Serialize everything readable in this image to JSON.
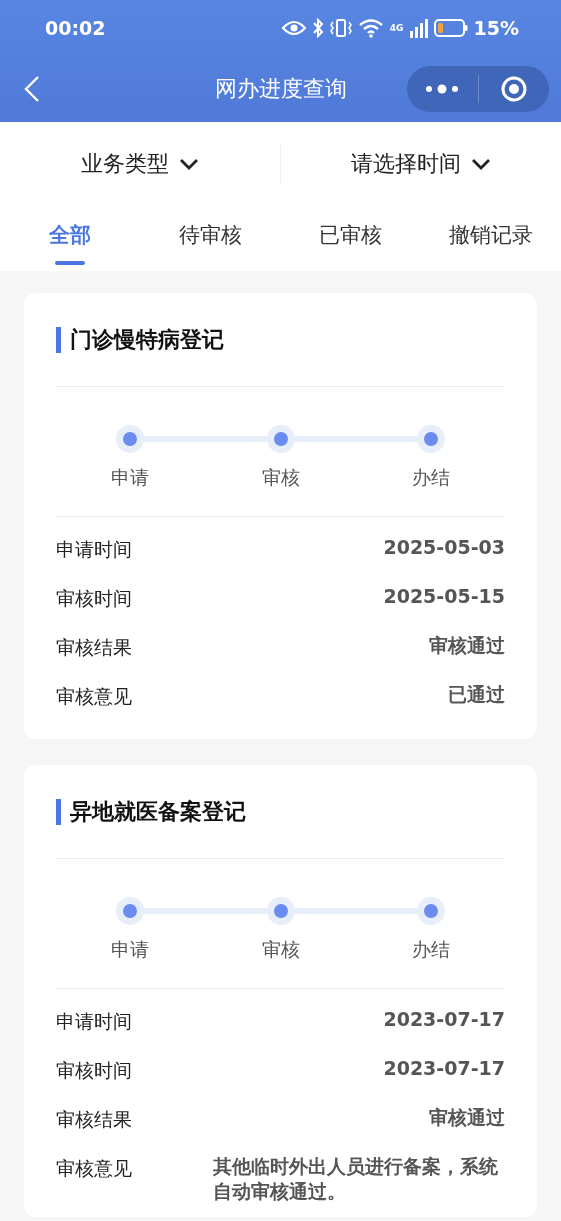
{
  "status_bar": {
    "time": "00:02",
    "network_type": "4G",
    "battery": "15%"
  },
  "nav_bar": {
    "title": "网办进度查询"
  },
  "filters": [
    {
      "label": "业务类型"
    },
    {
      "label": "请选择时间"
    }
  ],
  "tabs": [
    {
      "label": "全部",
      "selected": true
    },
    {
      "label": "待审核",
      "selected": false
    },
    {
      "label": "已审核",
      "selected": false
    },
    {
      "label": "撤销记录",
      "selected": false
    }
  ],
  "records": [
    {
      "title": "门诊慢特病登记",
      "steps": [
        {
          "label": "申请",
          "completed": true
        },
        {
          "label": "审核",
          "completed": true
        },
        {
          "label": "办结",
          "completed": true
        }
      ],
      "fields": [
        {
          "label": "申请时间",
          "value": "2025-05-03"
        },
        {
          "label": "审核时间",
          "value": "2025-05-15"
        },
        {
          "label": "审核结果",
          "value": "审核通过"
        },
        {
          "label": "审核意见",
          "value": "已通过"
        }
      ]
    },
    {
      "title": "异地就医备案登记",
      "steps": [
        {
          "label": "申请",
          "completed": true
        },
        {
          "label": "审核",
          "completed": true
        },
        {
          "label": "办结",
          "completed": true
        }
      ],
      "fields": [
        {
          "label": "申请时间",
          "value": "2023-07-17"
        },
        {
          "label": "审核时间",
          "value": "2023-07-17"
        },
        {
          "label": "审核结果",
          "value": "审核通过"
        },
        {
          "label": "审核意见",
          "value": "其他临时外出人员进行备案，系统自动审核通过。"
        }
      ]
    }
  ]
}
